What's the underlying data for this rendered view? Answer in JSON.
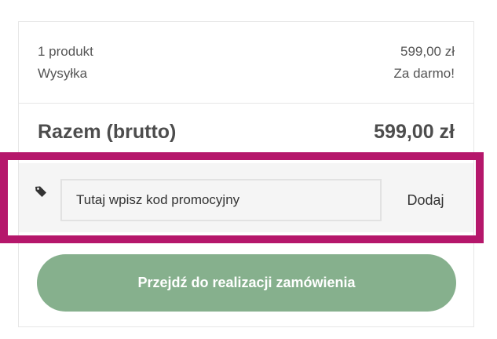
{
  "summary": {
    "items_label": "1 produkt",
    "items_price": "599,00 zł",
    "shipping_label": "Wysyłka",
    "shipping_value": "Za darmo!"
  },
  "total": {
    "label": "Razem (brutto)",
    "value": "599,00 zł"
  },
  "promo": {
    "icon": "tag-icon",
    "placeholder": "Tutaj wpisz kod promocyjny",
    "value": "",
    "add_label": "Dodaj"
  },
  "checkout": {
    "label": "Przejdź do realizacji zamówienia"
  },
  "colors": {
    "highlight": "#b5176b",
    "checkout_button": "#86b08d"
  }
}
